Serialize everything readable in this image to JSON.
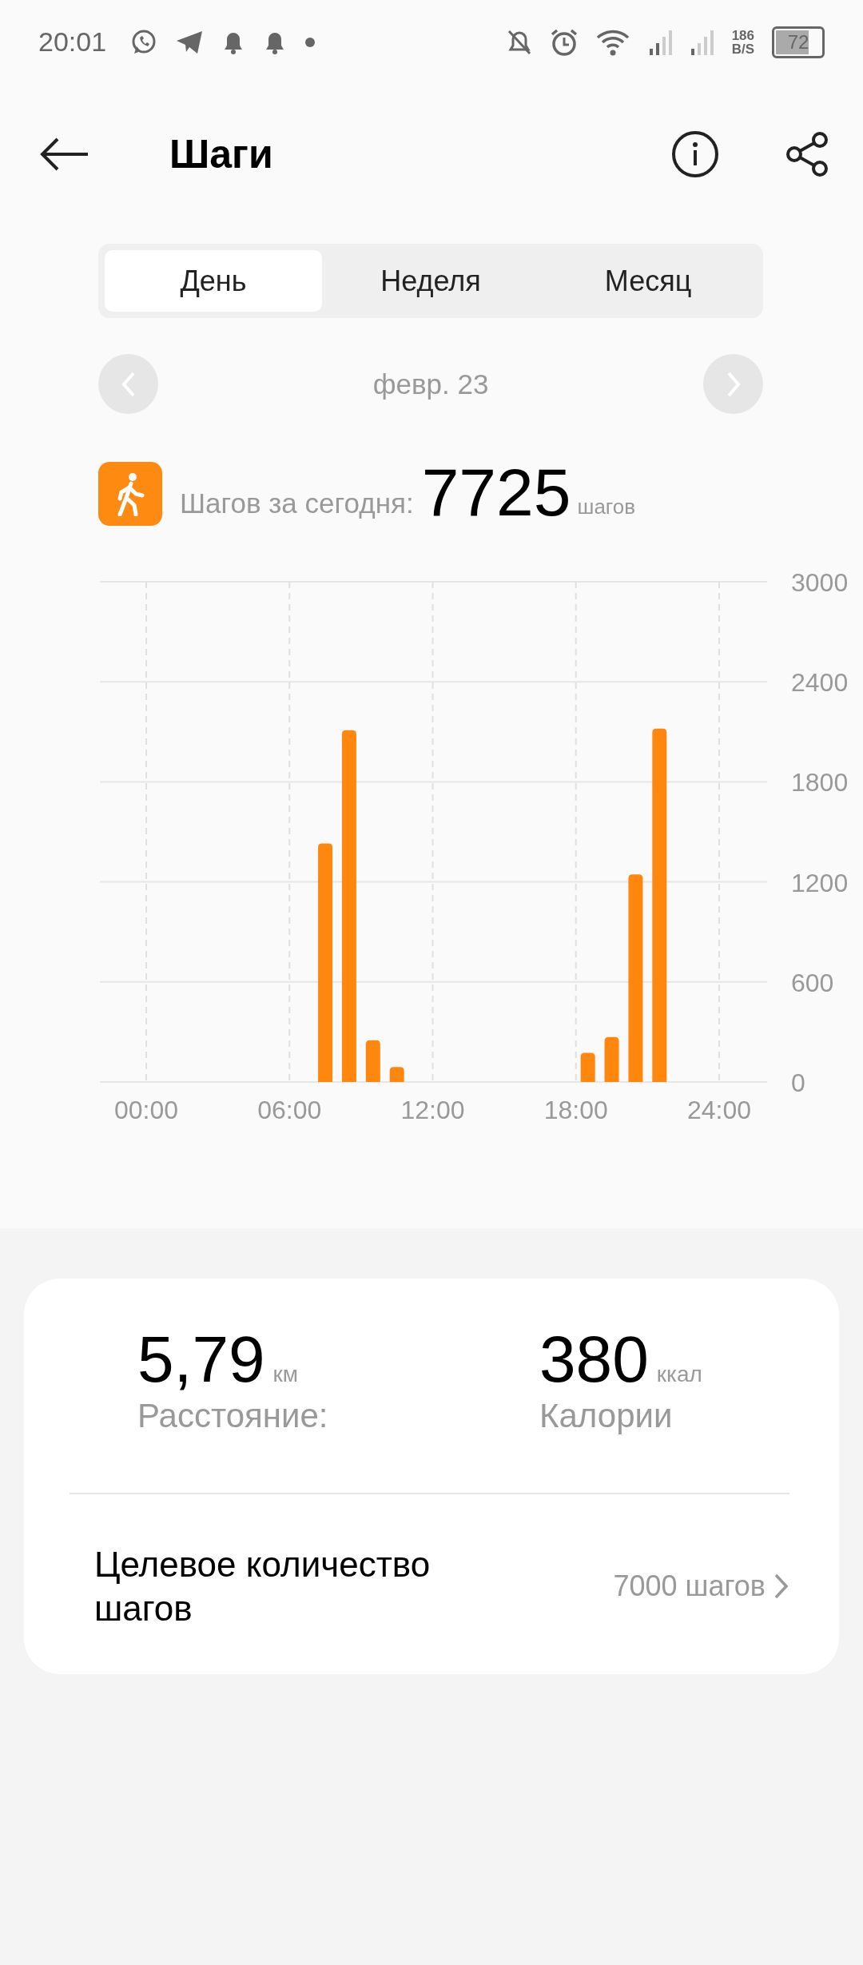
{
  "status_bar": {
    "time": "20:01",
    "network_speed": "186",
    "network_unit": "B/S",
    "battery": "72"
  },
  "header": {
    "title": "Шаги"
  },
  "tabs": [
    {
      "label": "День",
      "selected": true
    },
    {
      "label": "Неделя",
      "selected": false
    },
    {
      "label": "Месяц",
      "selected": false
    }
  ],
  "date": "февр. 23",
  "summary": {
    "label": "Шагов за сегодня:",
    "value": "7725",
    "unit": "шагов"
  },
  "chart_data": {
    "type": "bar",
    "grid": true,
    "x": [
      7.5,
      8.5,
      9.5,
      10.5,
      18.5,
      19.5,
      20.5,
      21.5
    ],
    "values": [
      1430,
      2110,
      250,
      90,
      175,
      270,
      1245,
      2120
    ],
    "xlim": [
      0,
      24
    ],
    "ylim": [
      0,
      3000
    ],
    "xticks": [
      {
        "value": 0,
        "label": "00:00"
      },
      {
        "value": 6,
        "label": "06:00"
      },
      {
        "value": 12,
        "label": "12:00"
      },
      {
        "value": 18,
        "label": "18:00"
      },
      {
        "value": 24,
        "label": "24:00"
      }
    ],
    "yticks": [
      0,
      600,
      1200,
      1800,
      2400,
      3000
    ]
  },
  "stats": [
    {
      "value": "5,79",
      "unit": "км",
      "label": "Расстояние:"
    },
    {
      "value": "380",
      "unit": "ккал",
      "label": "Калории"
    }
  ],
  "goal": {
    "label": "Целевое количество шагов",
    "value": "7000 шагов"
  }
}
